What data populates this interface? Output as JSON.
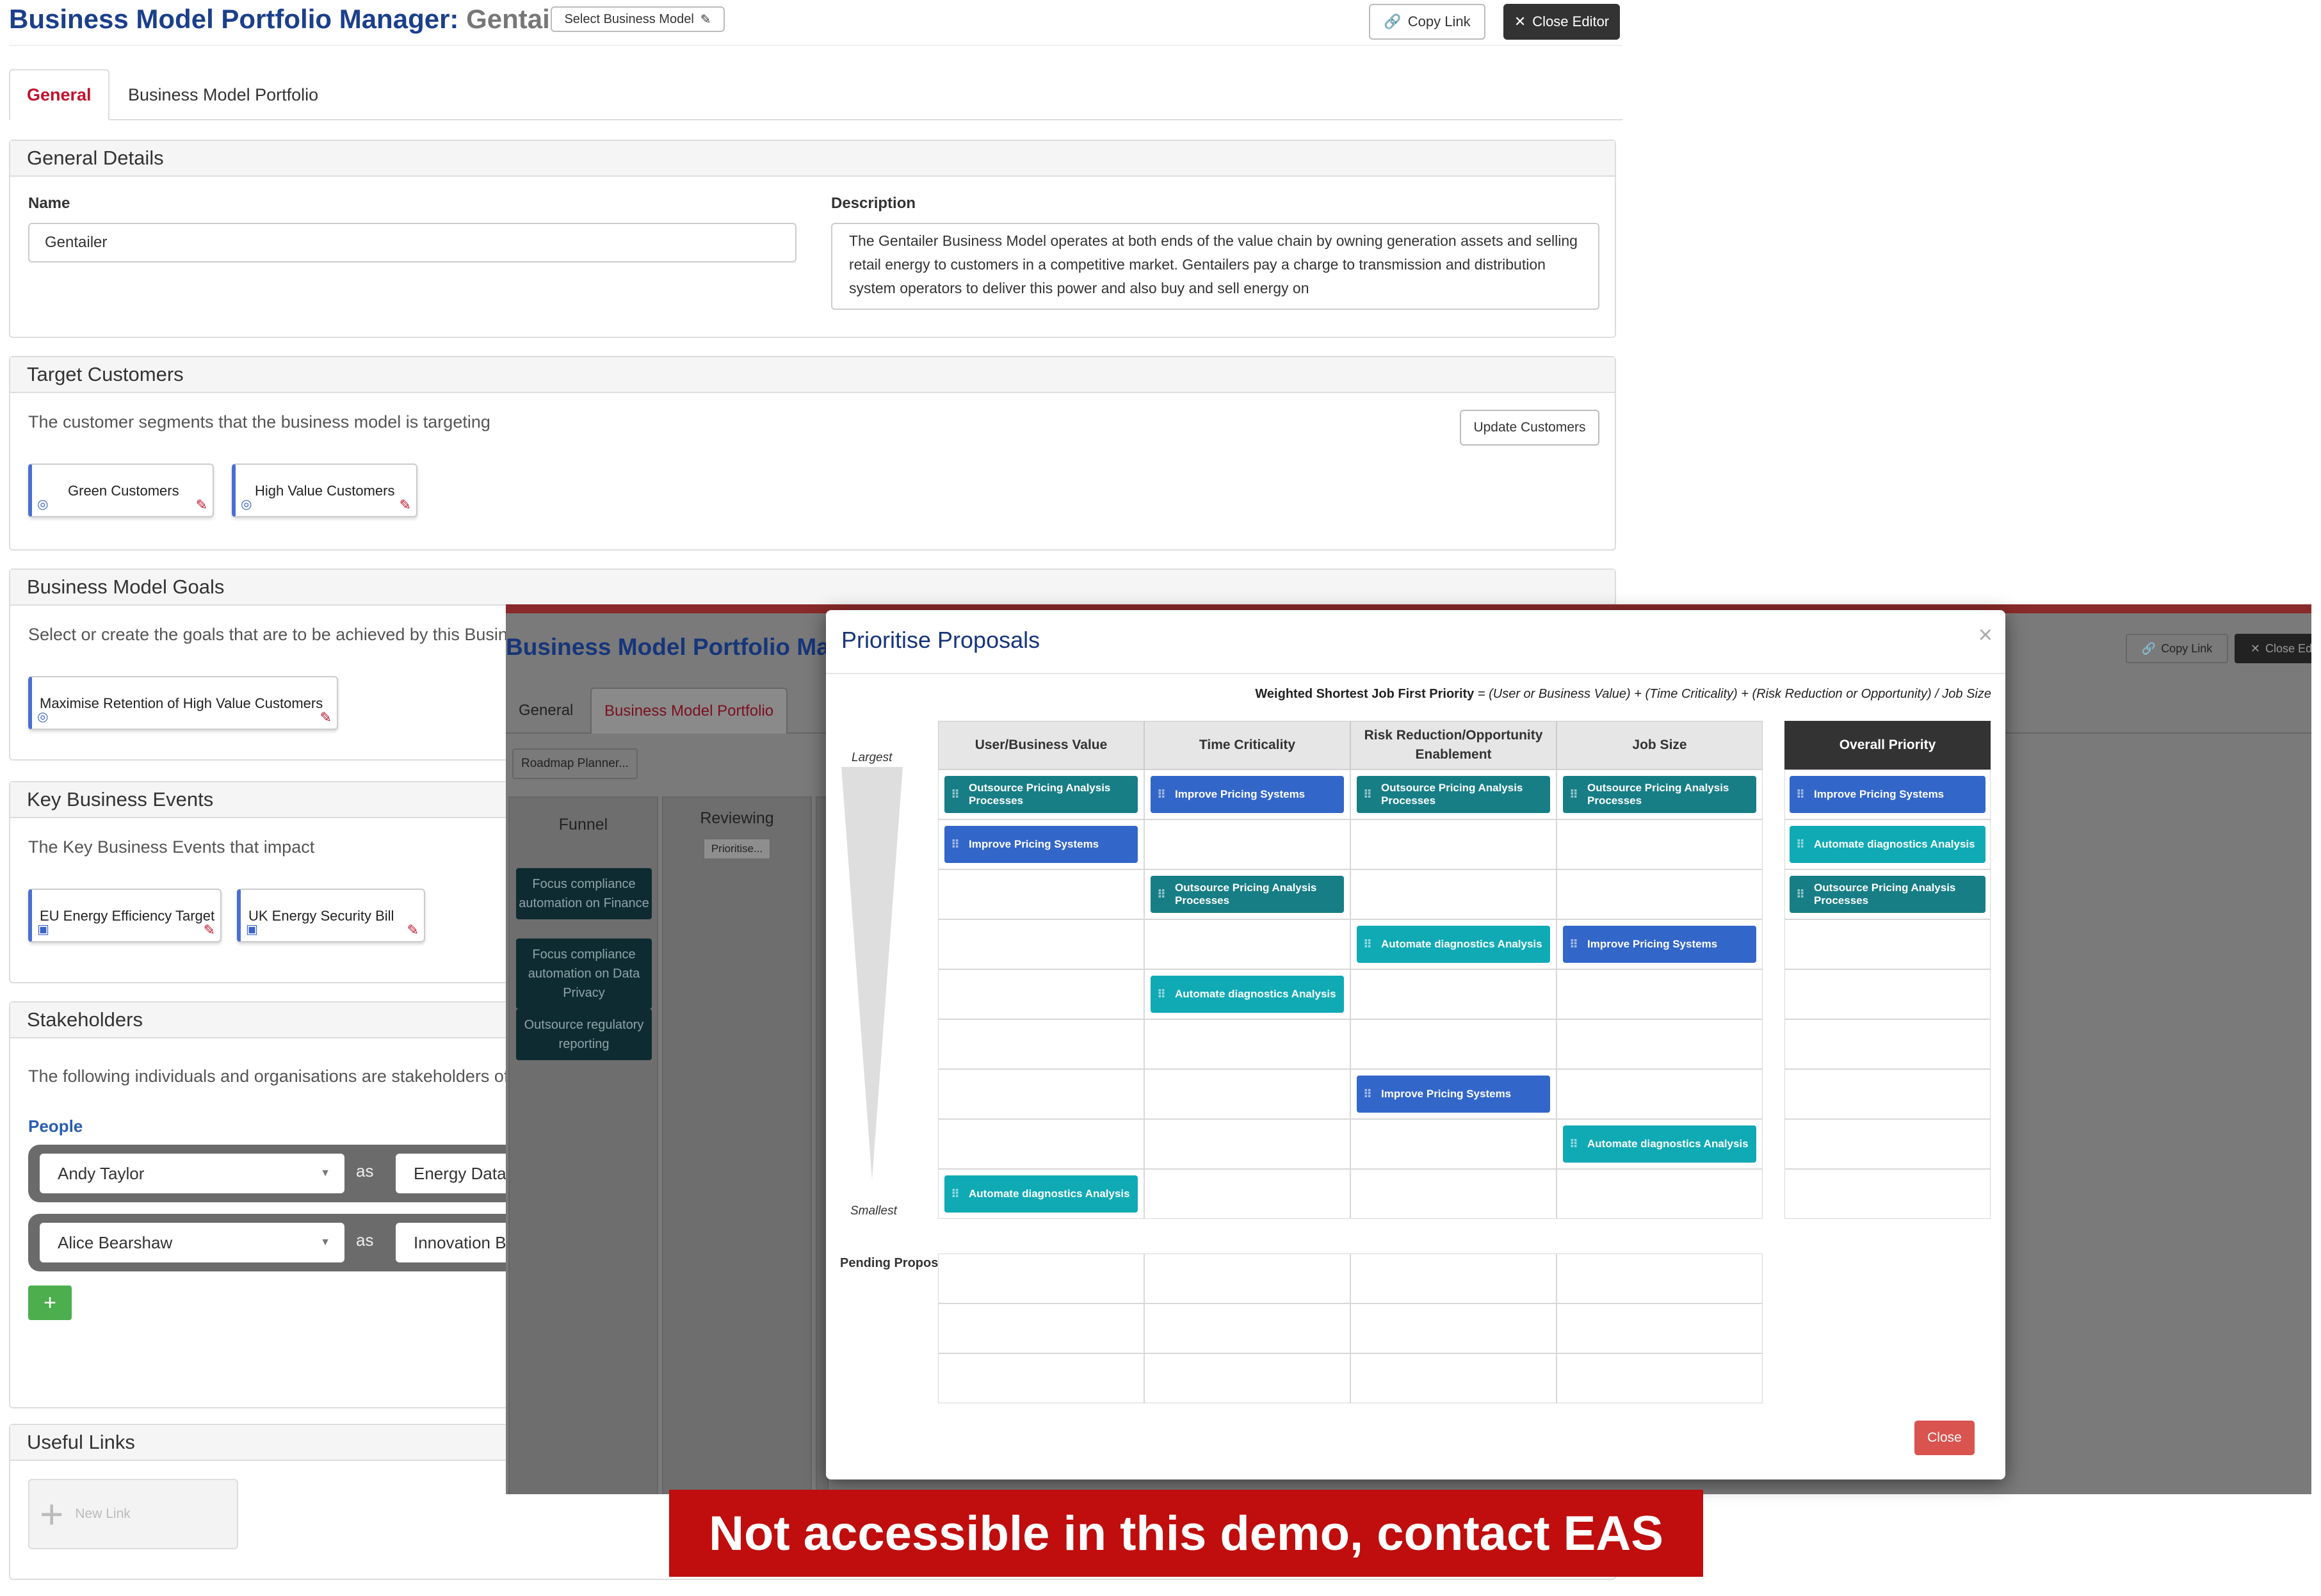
{
  "header": {
    "title_prefix": "Business Model Portfolio Manager:",
    "model_name": "Gentailer",
    "select_button": "Select Business Model",
    "copy_link": "Copy Link",
    "close_editor": "Close Editor"
  },
  "tabs": [
    "General",
    "Business Model Portfolio"
  ],
  "general_details": {
    "heading": "General Details",
    "name_label": "Name",
    "name_value": "Gentailer",
    "description_label": "Description",
    "description_value": "The Gentailer Business Model operates at both ends of the value chain by owning generation assets and selling retail energy to customers in a competitive market. Gentailers pay a charge to transmission and distribution system operators to deliver this power and also buy and sell energy on"
  },
  "target_customers": {
    "heading": "Target Customers",
    "intro": "The customer segments that the business model is targeting",
    "update_button": "Update Customers",
    "chips": [
      "Green Customers",
      "High Value Customers"
    ]
  },
  "goals": {
    "heading": "Business Model Goals",
    "intro": "Select or create the goals that are to be achieved by this Busin",
    "chips": [
      "Maximise Retention of High Value Customers"
    ]
  },
  "events": {
    "heading": "Key Business Events",
    "intro": "The Key Business Events that impact",
    "chips": [
      "EU Energy Efficiency Target",
      "UK Energy Security Bill"
    ]
  },
  "stakeholders": {
    "heading": "Stakeholders",
    "intro": "The following individuals and organisations are stakeholders of",
    "people_label": "People",
    "as_word": "as",
    "rows": [
      {
        "person": "Andy Taylor",
        "role": "Energy Data A"
      },
      {
        "person": "Alice Bearshaw",
        "role": "Innovation Bu"
      }
    ],
    "add_button": "+"
  },
  "useful_links": {
    "heading": "Useful Links",
    "new_link": "New Link"
  },
  "overlay": {
    "title": "Business Model Portfolio Manag",
    "copy_link": "Copy Link",
    "close_editor": "Close Edi",
    "tabs": [
      "General",
      "Business Model Portfolio"
    ],
    "roadmap_button": "Roadmap Planner...",
    "columns": [
      "Funnel",
      "Reviewing"
    ],
    "prioritise_button": "Prioritise...",
    "funnel_cards": [
      "Focus compliance automation on Finance",
      "Focus compliance automation on Data Privacy",
      "Outsource regulatory reporting"
    ]
  },
  "modal": {
    "title": "Prioritise Proposals",
    "close_x": "×",
    "formula_bold": "Weighted Shortest Job First Priority",
    "formula_rest": " = (User or Business Value) + (Time Criticality) + (Risk Reduction or Opportunity) / Job Size",
    "axis_top": "Largest",
    "axis_bottom": "Smallest",
    "pending_label": "Pending Proposals",
    "columns": [
      "User/Business Value",
      "Time Criticality",
      "Risk Reduction/Opportunity Enablement",
      "Job Size"
    ],
    "overall_heading": "Overall Priority",
    "close_button": "Close",
    "cards": [
      {
        "text": "Outsource Pricing Analysis Processes",
        "col": 0,
        "row": 0,
        "color": "teal"
      },
      {
        "text": "Improve Pricing Systems",
        "col": 0,
        "row": 1,
        "color": "blue"
      },
      {
        "text": "Automate diagnostics Analysis",
        "col": 0,
        "row": 8,
        "color": "cyan"
      },
      {
        "text": "Improve Pricing Systems",
        "col": 1,
        "row": 0,
        "color": "blue"
      },
      {
        "text": "Outsource Pricing Analysis Processes",
        "col": 1,
        "row": 2,
        "color": "teal"
      },
      {
        "text": "Automate diagnostics Analysis",
        "col": 1,
        "row": 4,
        "color": "cyan"
      },
      {
        "text": "Outsource Pricing Analysis Processes",
        "col": 2,
        "row": 0,
        "color": "teal"
      },
      {
        "text": "Automate diagnostics Analysis",
        "col": 2,
        "row": 3,
        "color": "cyan"
      },
      {
        "text": "Improve Pricing Systems",
        "col": 2,
        "row": 6,
        "color": "blue"
      },
      {
        "text": "Outsource Pricing Analysis Processes",
        "col": 3,
        "row": 0,
        "color": "teal"
      },
      {
        "text": "Improve Pricing Systems",
        "col": 3,
        "row": 3,
        "color": "blue"
      },
      {
        "text": "Automate diagnostics Analysis",
        "col": 3,
        "row": 7,
        "color": "cyan"
      }
    ],
    "overall": [
      {
        "text": "Improve Pricing Systems",
        "color": "blue"
      },
      {
        "text": "Automate diagnostics Analysis",
        "color": "cyan"
      },
      {
        "text": "Outsource Pricing Analysis Processes",
        "color": "teal"
      }
    ],
    "colors": {
      "blue": "#3366c9",
      "teal": "#177e86",
      "cyan": "#10aab5"
    }
  },
  "banner": "Not accessible in this demo, contact EAS"
}
